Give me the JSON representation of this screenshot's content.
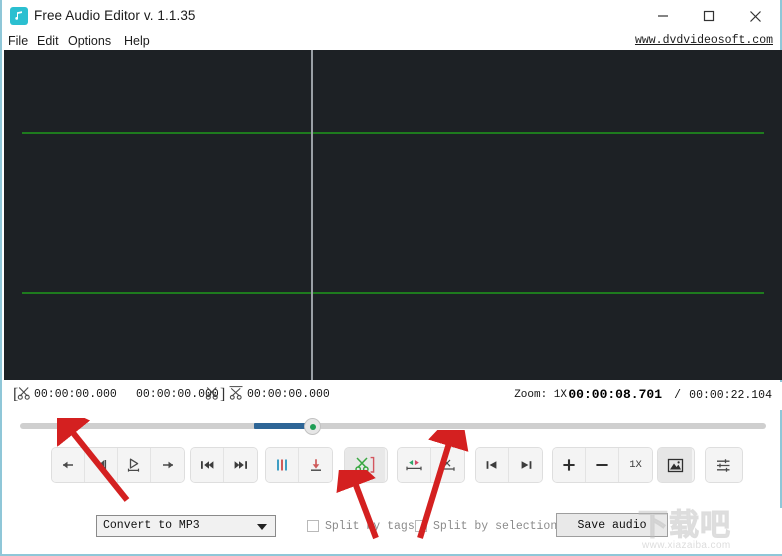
{
  "window": {
    "title": "Free Audio Editor v. 1.1.35",
    "icon": "music-note-icon",
    "minimize": "minimize-icon",
    "maximize": "maximize-icon",
    "close": "close-icon"
  },
  "menu": {
    "items": [
      {
        "label": "File"
      },
      {
        "label": "Edit"
      },
      {
        "label": "Options"
      },
      {
        "label": "Help"
      }
    ]
  },
  "link": {
    "label": "www.dvdvideosoft.com"
  },
  "waveform": {
    "background_color": "#1d2125",
    "channel_line_color": "#1e7b1e",
    "playhead_color": "#9aa0a6",
    "channels": 2
  },
  "timecode": {
    "selection_start": "00:00:00.000",
    "selection_end": "00:00:00.000",
    "cursor": "00:00:00.000",
    "zoom_label": "Zoom: 1X",
    "current_time": "00:00:08.701",
    "separator": "/",
    "total_time": "00:00:22.104"
  },
  "seek": {
    "position_percent": 40,
    "fill_color": "#2d6596",
    "track_color": "#cfcfcf",
    "handle_dot_color": "#1f9d55"
  },
  "toolbar": {
    "groups": [
      {
        "name": "nav",
        "buttons": [
          {
            "name": "step-back-button",
            "icon": "arrow-left-icon"
          },
          {
            "name": "goto-start-marker-button",
            "icon": "marker-left-icon"
          },
          {
            "name": "play-button",
            "icon": "play-icon"
          },
          {
            "name": "step-forward-button",
            "icon": "arrow-right-icon"
          }
        ]
      },
      {
        "name": "skip",
        "buttons": [
          {
            "name": "previous-track-button",
            "icon": "skip-back-icon"
          },
          {
            "name": "next-track-button",
            "icon": "skip-forward-icon"
          }
        ]
      },
      {
        "name": "marks",
        "buttons": [
          {
            "name": "markers-button",
            "icon": "bars-icon"
          },
          {
            "name": "add-marker-button",
            "icon": "arrow-down-to-line-icon"
          }
        ]
      },
      {
        "name": "cut",
        "buttons": [
          {
            "name": "cut-selection-button",
            "icon": "scissors-bracket-icon"
          }
        ]
      },
      {
        "name": "selection",
        "buttons": [
          {
            "name": "select-range-button",
            "icon": "arrows-inward-icon"
          },
          {
            "name": "trim-button",
            "icon": "cut-line-icon"
          }
        ]
      },
      {
        "name": "edge",
        "buttons": [
          {
            "name": "jump-to-start-button",
            "icon": "to-start-icon"
          },
          {
            "name": "jump-to-end-button",
            "icon": "to-end-icon"
          }
        ]
      },
      {
        "name": "zoom",
        "buttons": [
          {
            "name": "zoom-in-button",
            "icon": "plus-icon"
          },
          {
            "name": "zoom-out-button",
            "icon": "minus-icon"
          },
          {
            "name": "zoom-reset-button",
            "icon": "text",
            "label": "1X"
          }
        ]
      },
      {
        "name": "view",
        "buttons": [
          {
            "name": "waveform-view-button",
            "icon": "image-icon"
          }
        ]
      },
      {
        "name": "equalizer",
        "buttons": [
          {
            "name": "settings-sliders-button",
            "icon": "sliders-icon"
          }
        ]
      }
    ]
  },
  "bottom": {
    "format": {
      "selected": "Convert to MP3",
      "options": [
        "Convert to MP3"
      ]
    },
    "checkbox_split_tags": {
      "label": "Split by tags",
      "checked": false
    },
    "checkbox_split_selections": {
      "label": "Split by selections",
      "checked": false
    },
    "save_button": {
      "label": "Save audio"
    }
  },
  "watermark": {
    "cn_text": "下载吧",
    "url": "www.xiazaiba.com"
  },
  "annotations": {
    "arrow_color": "#d42020",
    "arrows": [
      {
        "name": "arrow-to-play-controls"
      },
      {
        "name": "arrow-to-cut-button"
      },
      {
        "name": "arrow-to-trim-button"
      }
    ]
  }
}
